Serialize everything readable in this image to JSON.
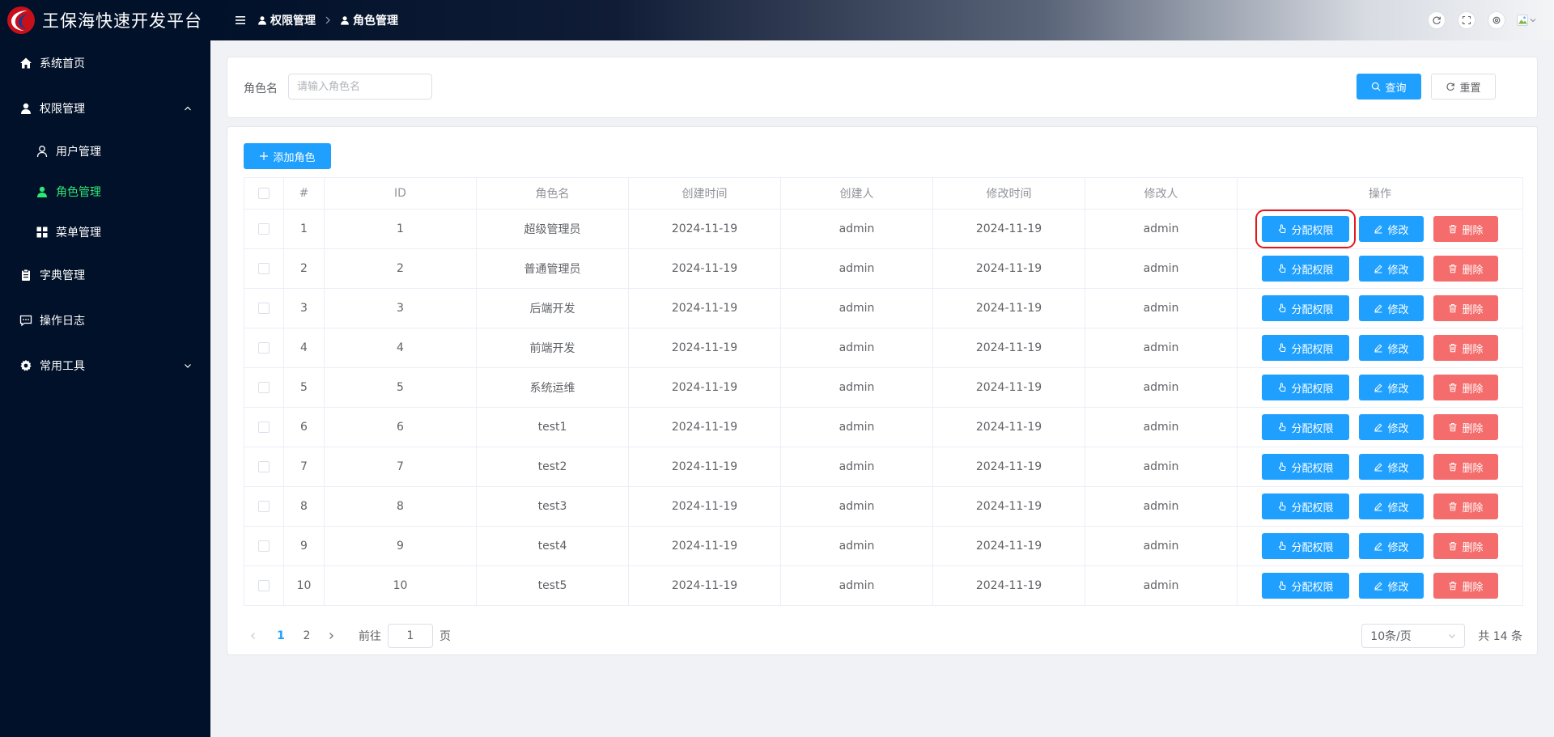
{
  "app": {
    "title": "王保海快速开发平台"
  },
  "sidebar": {
    "items": [
      {
        "label": "系统首页",
        "icon": "home-icon"
      },
      {
        "label": "权限管理",
        "icon": "user-shield-icon",
        "expanded": true,
        "children": [
          {
            "label": "用户管理",
            "icon": "user-outline-icon"
          },
          {
            "label": "角色管理",
            "icon": "user-filled-icon",
            "active": true
          },
          {
            "label": "菜单管理",
            "icon": "grid-icon"
          }
        ]
      },
      {
        "label": "字典管理",
        "icon": "clipboard-icon"
      },
      {
        "label": "操作日志",
        "icon": "chat-icon"
      },
      {
        "label": "常用工具",
        "icon": "gear-icon",
        "expanded": false
      }
    ],
    "active_color": "#2fe574"
  },
  "header": {
    "breadcrumb": [
      "权限管理",
      "角色管理"
    ]
  },
  "search": {
    "label": "角色名",
    "placeholder": "请输入角色名",
    "value": "",
    "query_label": "查询",
    "reset_label": "重置"
  },
  "toolbar": {
    "add_label": "添加角色"
  },
  "table": {
    "columns": [
      "#",
      "ID",
      "角色名",
      "创建时间",
      "创建人",
      "修改时间",
      "修改人",
      "操作"
    ],
    "rows": [
      {
        "index": "1",
        "id": "1",
        "name": "超级管理员",
        "created": "2024-11-19",
        "creator": "admin",
        "modified": "2024-11-19",
        "modifier": "admin"
      },
      {
        "index": "2",
        "id": "2",
        "name": "普通管理员",
        "created": "2024-11-19",
        "creator": "admin",
        "modified": "2024-11-19",
        "modifier": "admin"
      },
      {
        "index": "3",
        "id": "3",
        "name": "后端开发",
        "created": "2024-11-19",
        "creator": "admin",
        "modified": "2024-11-19",
        "modifier": "admin"
      },
      {
        "index": "4",
        "id": "4",
        "name": "前端开发",
        "created": "2024-11-19",
        "creator": "admin",
        "modified": "2024-11-19",
        "modifier": "admin"
      },
      {
        "index": "5",
        "id": "5",
        "name": "系统运维",
        "created": "2024-11-19",
        "creator": "admin",
        "modified": "2024-11-19",
        "modifier": "admin"
      },
      {
        "index": "6",
        "id": "6",
        "name": "test1",
        "created": "2024-11-19",
        "creator": "admin",
        "modified": "2024-11-19",
        "modifier": "admin"
      },
      {
        "index": "7",
        "id": "7",
        "name": "test2",
        "created": "2024-11-19",
        "creator": "admin",
        "modified": "2024-11-19",
        "modifier": "admin"
      },
      {
        "index": "8",
        "id": "8",
        "name": "test3",
        "created": "2024-11-19",
        "creator": "admin",
        "modified": "2024-11-19",
        "modifier": "admin"
      },
      {
        "index": "9",
        "id": "9",
        "name": "test4",
        "created": "2024-11-19",
        "creator": "admin",
        "modified": "2024-11-19",
        "modifier": "admin"
      },
      {
        "index": "10",
        "id": "10",
        "name": "test5",
        "created": "2024-11-19",
        "creator": "admin",
        "modified": "2024-11-19",
        "modifier": "admin"
      }
    ],
    "actions": {
      "assign": "分配权限",
      "edit": "修改",
      "delete": "删除"
    },
    "highlighted_action_row": 0
  },
  "pagination": {
    "pages": [
      "1",
      "2"
    ],
    "current": "1",
    "jump_label": "前往",
    "jump_value": "1",
    "jump_suffix": "页",
    "page_size": "10条/页",
    "total": "共 14 条"
  },
  "colors": {
    "primary": "#1fa0ff",
    "danger": "#f56c6c",
    "sidebar_bg": "#011129",
    "highlight": "#e0191c"
  }
}
